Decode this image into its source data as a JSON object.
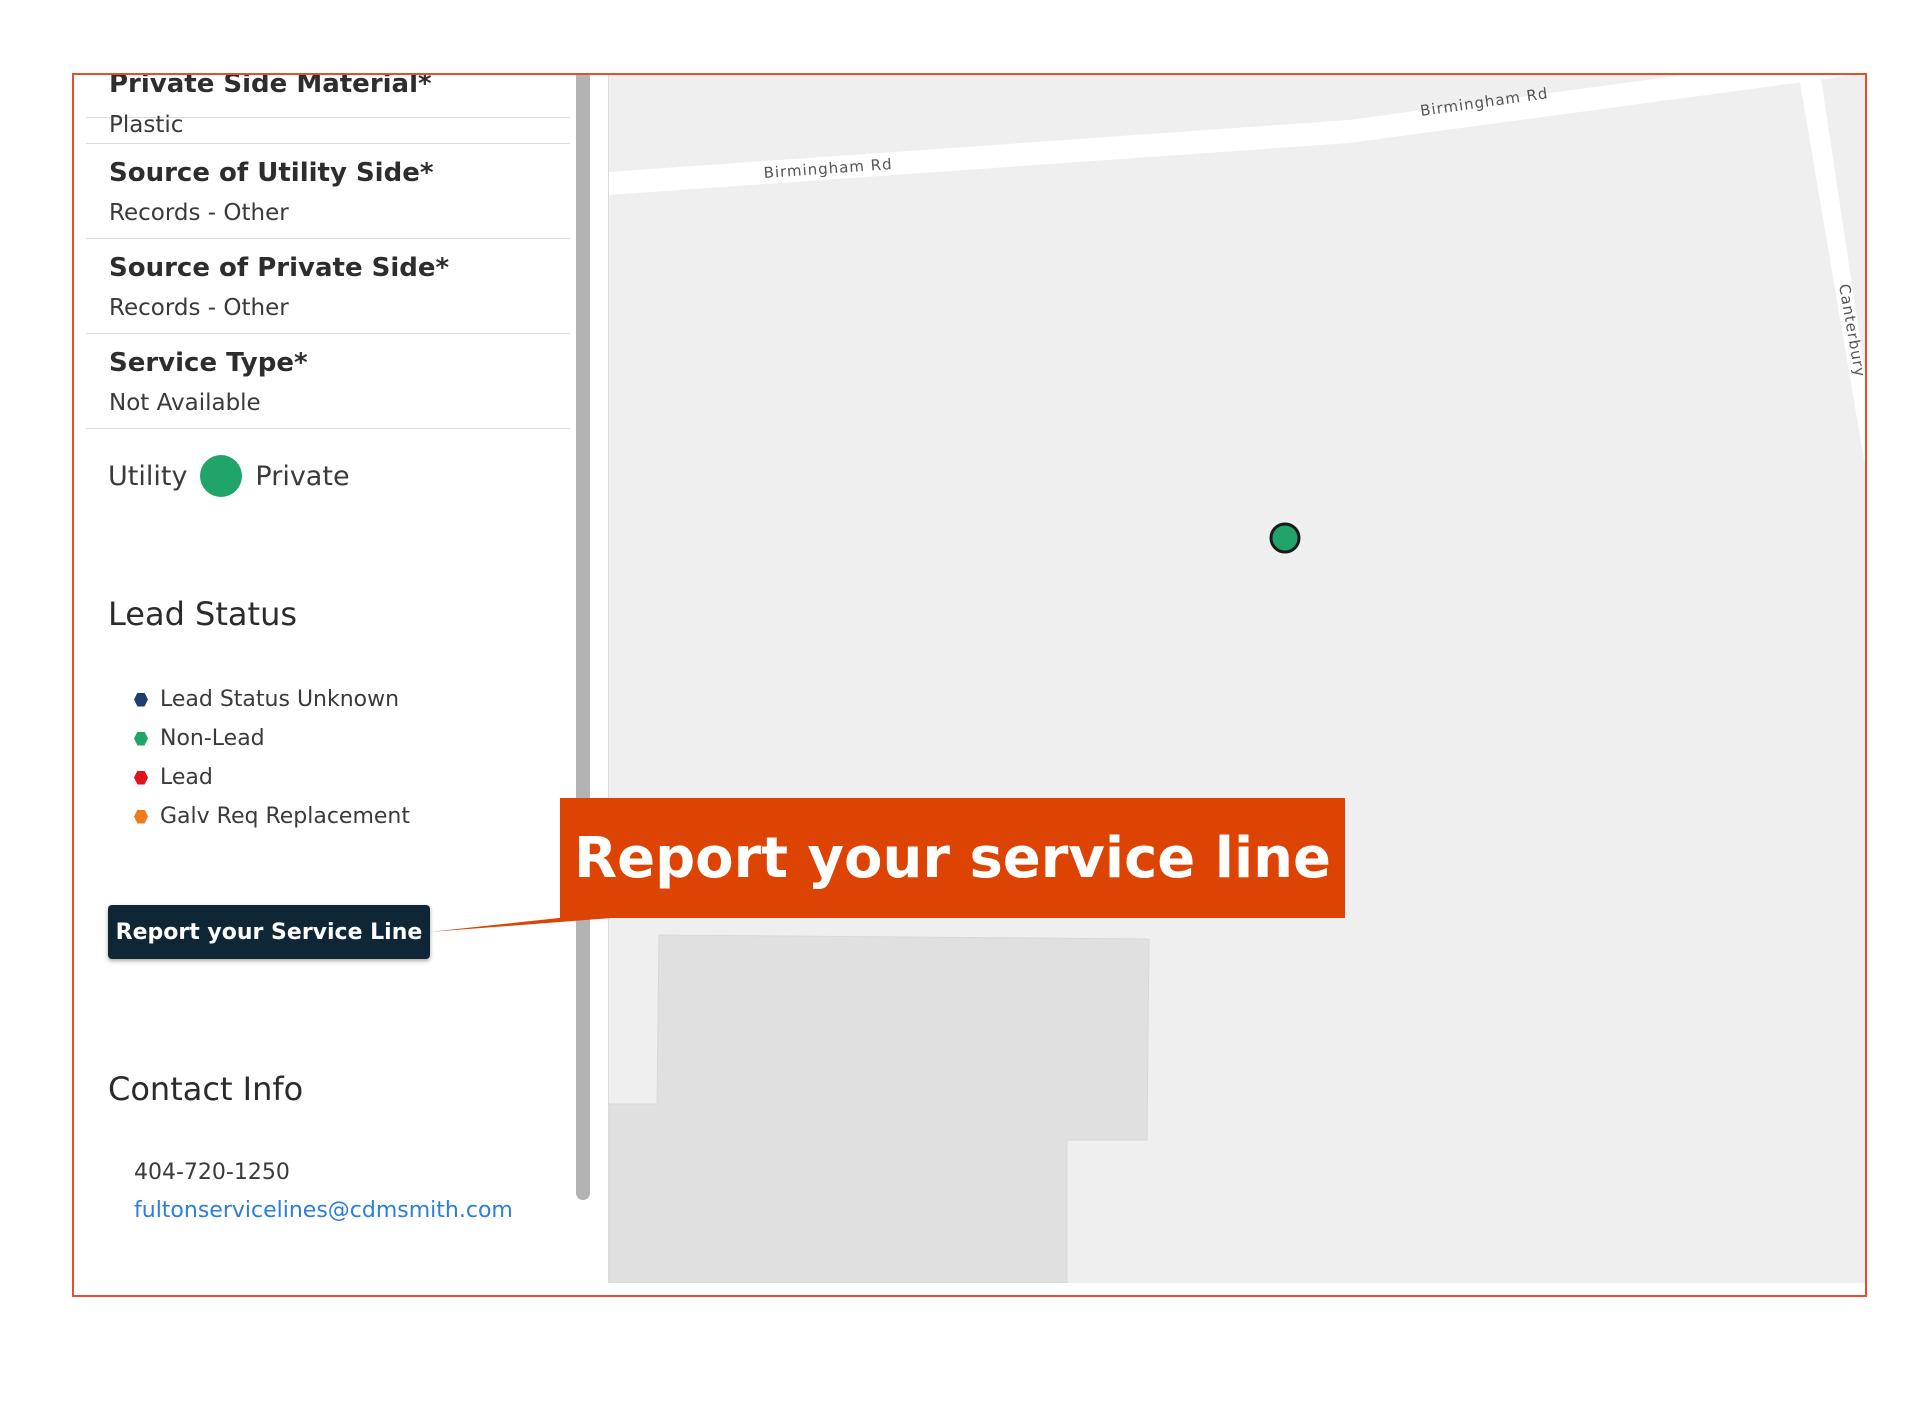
{
  "fields": [
    {
      "label": "Private Side Material*",
      "value": "Plastic"
    },
    {
      "label": "Source of Utility Side*",
      "value": "Records - Other"
    },
    {
      "label": "Source of Private Side*",
      "value": "Records - Other"
    },
    {
      "label": "Service Type*",
      "value": "Not Available"
    }
  ],
  "ownership": {
    "utility_label": "Utility",
    "private_label": "Private",
    "status_color": "#21a46a"
  },
  "lead_status": {
    "title": "Lead Status",
    "items": [
      {
        "label": "Lead Status Unknown",
        "color": "#1f3f6e"
      },
      {
        "label": "Non-Lead",
        "color": "#21a46a"
      },
      {
        "label": "Lead",
        "color": "#e3111b"
      },
      {
        "label": "Galv Req Replacement",
        "color": "#f07b1c"
      }
    ]
  },
  "report_button": {
    "label": "Report your Service Line"
  },
  "contact": {
    "title": "Contact Info",
    "phone": "404-720-1250",
    "email": "fultonservicelines@cdmsmith.com"
  },
  "map": {
    "road_labels": [
      "Birmingham Rd",
      "Birmingham Rd",
      "Canterbury"
    ],
    "marker_color": "#21a46a"
  },
  "callout": {
    "text": "Report your service line",
    "color": "#dd4303"
  },
  "frame_color": "#e4502b"
}
